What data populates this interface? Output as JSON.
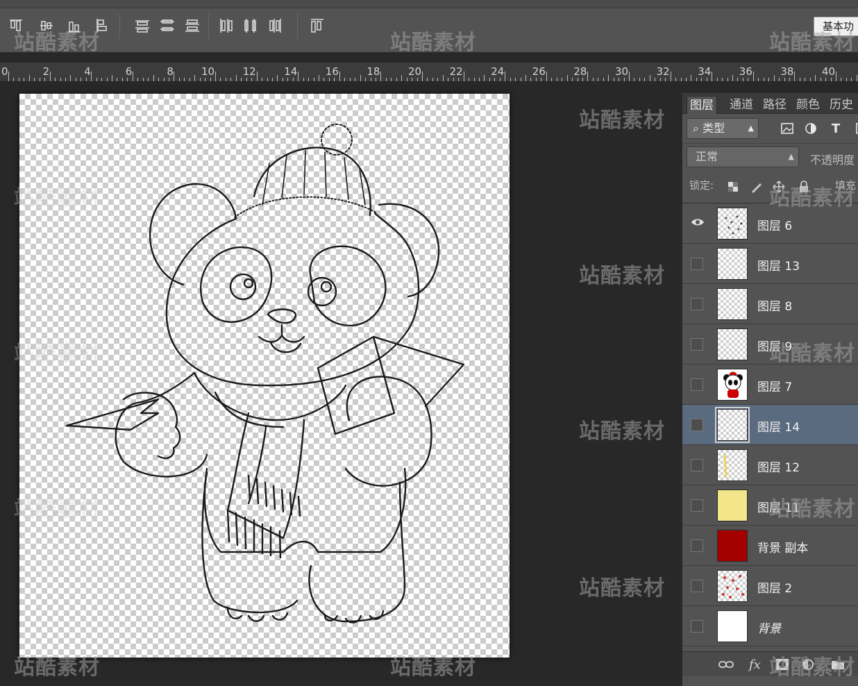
{
  "options_bar": {
    "workspace_button": "基本功",
    "align_buttons": [
      "align-top-edges-icon",
      "align-vertical-centers-icon",
      "align-bottom-edges-icon",
      "align-left-edges-icon",
      "distribute-top-icon",
      "distribute-vertical-centers-icon",
      "distribute-bottom-icon",
      "distribute-left-icon",
      "distribute-horizontal-centers-icon",
      "distribute-right-icon",
      "auto-align-icon"
    ]
  },
  "ruler": {
    "labels": [
      "0",
      "2",
      "4",
      "6",
      "8",
      "10",
      "12",
      "14",
      "16",
      "18",
      "20",
      "22",
      "24",
      "26",
      "28",
      "30",
      "32",
      "34",
      "36",
      "38",
      "40"
    ]
  },
  "panel": {
    "tabs": [
      "图层",
      "通道",
      "路径",
      "颜色",
      "历史"
    ],
    "filter_kind": "类型",
    "filter_icons": [
      "image-filter-icon",
      "adjustment-filter-icon",
      "text-filter-icon",
      "shape-filter-icon"
    ],
    "filter_text_glyph": "T",
    "blend_mode": "正常",
    "opacity_label": "不透明度",
    "lock_label": "锁定:",
    "fill_label": "填充"
  },
  "layers": [
    {
      "name": "图层 6",
      "visible": true,
      "thumb": "checker-dots"
    },
    {
      "name": "图层 13",
      "visible": false,
      "thumb": "checker"
    },
    {
      "name": "图层 8",
      "visible": false,
      "thumb": "checker"
    },
    {
      "name": "图层 9",
      "visible": false,
      "thumb": "checker"
    },
    {
      "name": "图层 7",
      "visible": false,
      "thumb": "panda"
    },
    {
      "name": "图层 14",
      "visible": false,
      "thumb": "checker",
      "selected": true
    },
    {
      "name": "图层 12",
      "visible": false,
      "thumb": "checker-yellow-line"
    },
    {
      "name": "图层 11",
      "visible": false,
      "thumb": "yellow"
    },
    {
      "name": "背景 副本",
      "visible": false,
      "thumb": "red"
    },
    {
      "name": "图层 2",
      "visible": false,
      "thumb": "checker-red-dots"
    },
    {
      "name": "背景",
      "visible": false,
      "thumb": "white",
      "italic": true
    }
  ],
  "footer": {
    "icons": [
      "link-layers-icon",
      "fx-icon",
      "add-mask-icon",
      "adjustment-layer-icon",
      "new-group-icon"
    ],
    "fx_label": "fx"
  },
  "watermark": "站酷素材",
  "colors": {
    "selected_layer": "#5b6b7f",
    "red_layer": "#a50000",
    "yellow_layer": "#f3e58a"
  }
}
